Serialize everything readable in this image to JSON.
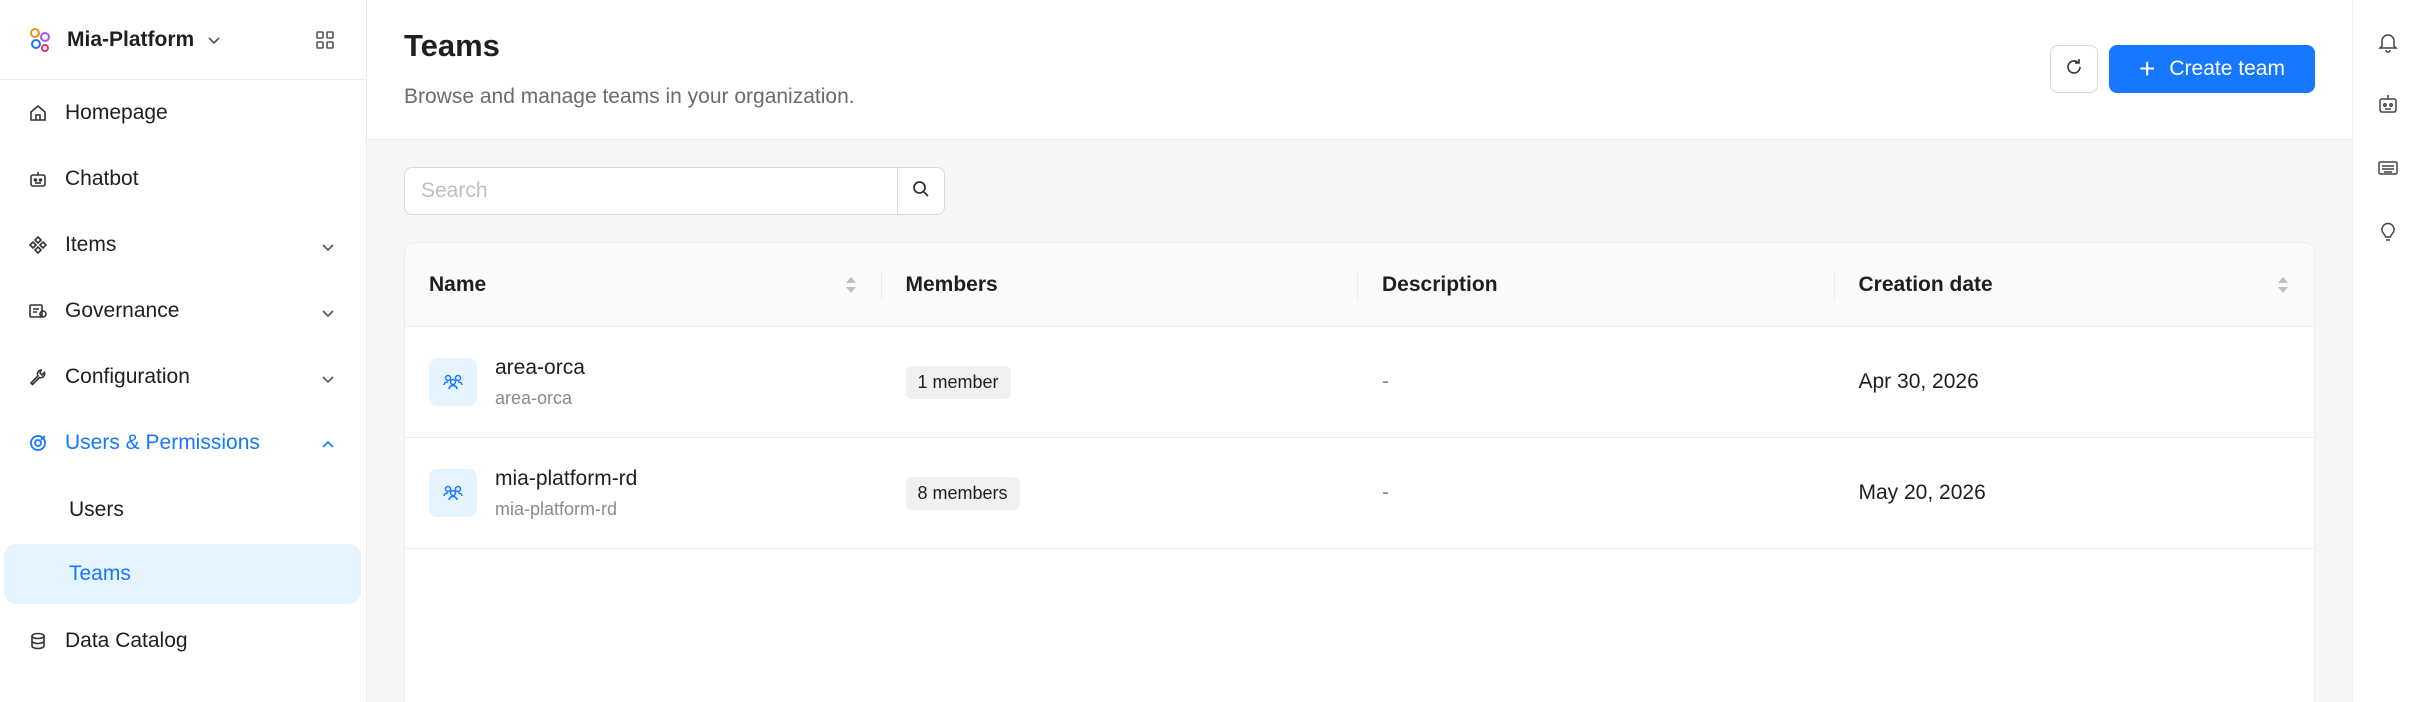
{
  "sidebar": {
    "brand": "Mia-Platform",
    "items": [
      {
        "label": "Homepage",
        "icon": "home-icon"
      },
      {
        "label": "Chatbot",
        "icon": "robot-icon"
      },
      {
        "label": "Items",
        "icon": "items-icon"
      },
      {
        "label": "Governance",
        "icon": "governance-icon"
      },
      {
        "label": "Configuration",
        "icon": "wrench-icon"
      },
      {
        "label": "Users & Permissions",
        "icon": "users-permissions-icon"
      },
      {
        "label": "Data Catalog",
        "icon": "database-icon"
      }
    ],
    "sub_items": [
      {
        "label": "Users"
      },
      {
        "label": "Teams"
      }
    ],
    "accent_color": "#1677ff"
  },
  "header": {
    "title": "Teams",
    "subtitle": "Browse and manage teams in your organization.",
    "create_label": "Create team"
  },
  "search": {
    "placeholder": "Search"
  },
  "table": {
    "columns": [
      "Name",
      "Members",
      "Description",
      "Creation date"
    ],
    "rows": [
      {
        "name": "area-orca",
        "slug": "area-orca",
        "members": "1 member",
        "description": "-",
        "created": "Apr 30, 2026"
      },
      {
        "name": "mia-platform-rd",
        "slug": "mia-platform-rd",
        "members": "8 members",
        "description": "-",
        "created": "May 20, 2026"
      }
    ]
  },
  "rail": {
    "icons": [
      "bell-icon",
      "robot-icon",
      "keyboard-icon",
      "lightbulb-icon"
    ]
  }
}
